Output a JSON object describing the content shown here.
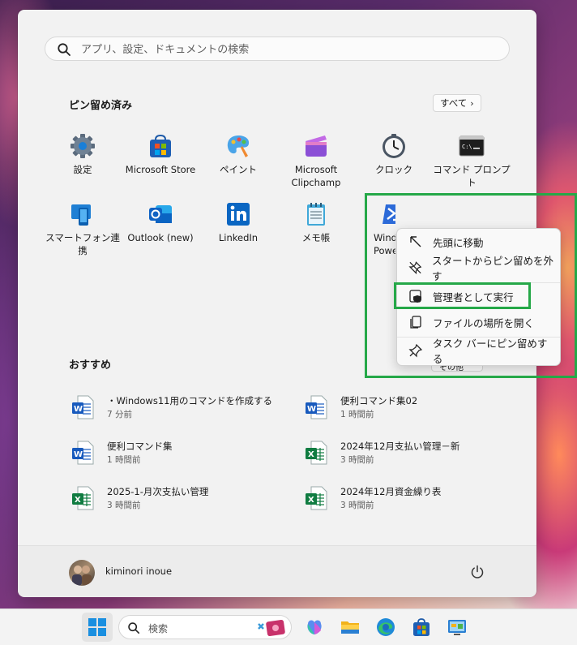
{
  "search": {
    "placeholder": "アプリ、設定、ドキュメントの検索"
  },
  "pinned": {
    "title": "ピン留め済み",
    "all_button": "すべて",
    "apps": [
      {
        "label": "設定",
        "icon": "settings-icon"
      },
      {
        "label": "Microsoft Store",
        "icon": "store-icon"
      },
      {
        "label": "ペイント",
        "icon": "paint-icon"
      },
      {
        "label": "Microsoft\nClipchamp",
        "icon": "clipchamp-icon"
      },
      {
        "label": "クロック",
        "icon": "clock-icon"
      },
      {
        "label": "コマンド プロンプト",
        "icon": "command-prompt-icon"
      },
      {
        "label": "スマートフォン連携",
        "icon": "phone-link-icon"
      },
      {
        "label": "Outlook (new)",
        "icon": "outlook-icon"
      },
      {
        "label": "LinkedIn",
        "icon": "linkedin-icon"
      },
      {
        "label": "メモ帳",
        "icon": "notepad-icon"
      },
      {
        "label": "Wind\nPowe",
        "icon": "powershell-icon"
      }
    ]
  },
  "recommended": {
    "title": "おすすめ",
    "more_button": "その他",
    "items": [
      {
        "name": "・Windows11用のコマンドを作成する",
        "time": "7 分前",
        "type": "word"
      },
      {
        "name": "便利コマンド集02",
        "time": "1 時間前",
        "type": "word"
      },
      {
        "name": "便利コマンド集",
        "time": "1 時間前",
        "type": "word"
      },
      {
        "name": "2024年12月支払い管理－新",
        "time": "3 時間前",
        "type": "excel"
      },
      {
        "name": "2025-1-月次支払い管理",
        "time": "3 時間前",
        "type": "excel"
      },
      {
        "name": "2024年12月資金繰り表",
        "time": "3 時間前",
        "type": "excel"
      }
    ]
  },
  "user": {
    "name": "kiminori inoue"
  },
  "context_menu": {
    "items": [
      {
        "label": "先頭に移動",
        "icon": "move-to-top-icon"
      },
      {
        "label": "スタートからピン留めを外す",
        "icon": "unpin-icon"
      },
      {
        "label": "管理者として実行",
        "icon": "shield-icon"
      },
      {
        "label": "ファイルの場所を開く",
        "icon": "file-location-icon"
      },
      {
        "label": "タスク バーにピン留めする",
        "icon": "pin-icon"
      }
    ]
  },
  "taskbar": {
    "search_label": "検索"
  },
  "colors": {
    "highlight": "#25a848",
    "word": "#185abd",
    "excel": "#107c41"
  }
}
